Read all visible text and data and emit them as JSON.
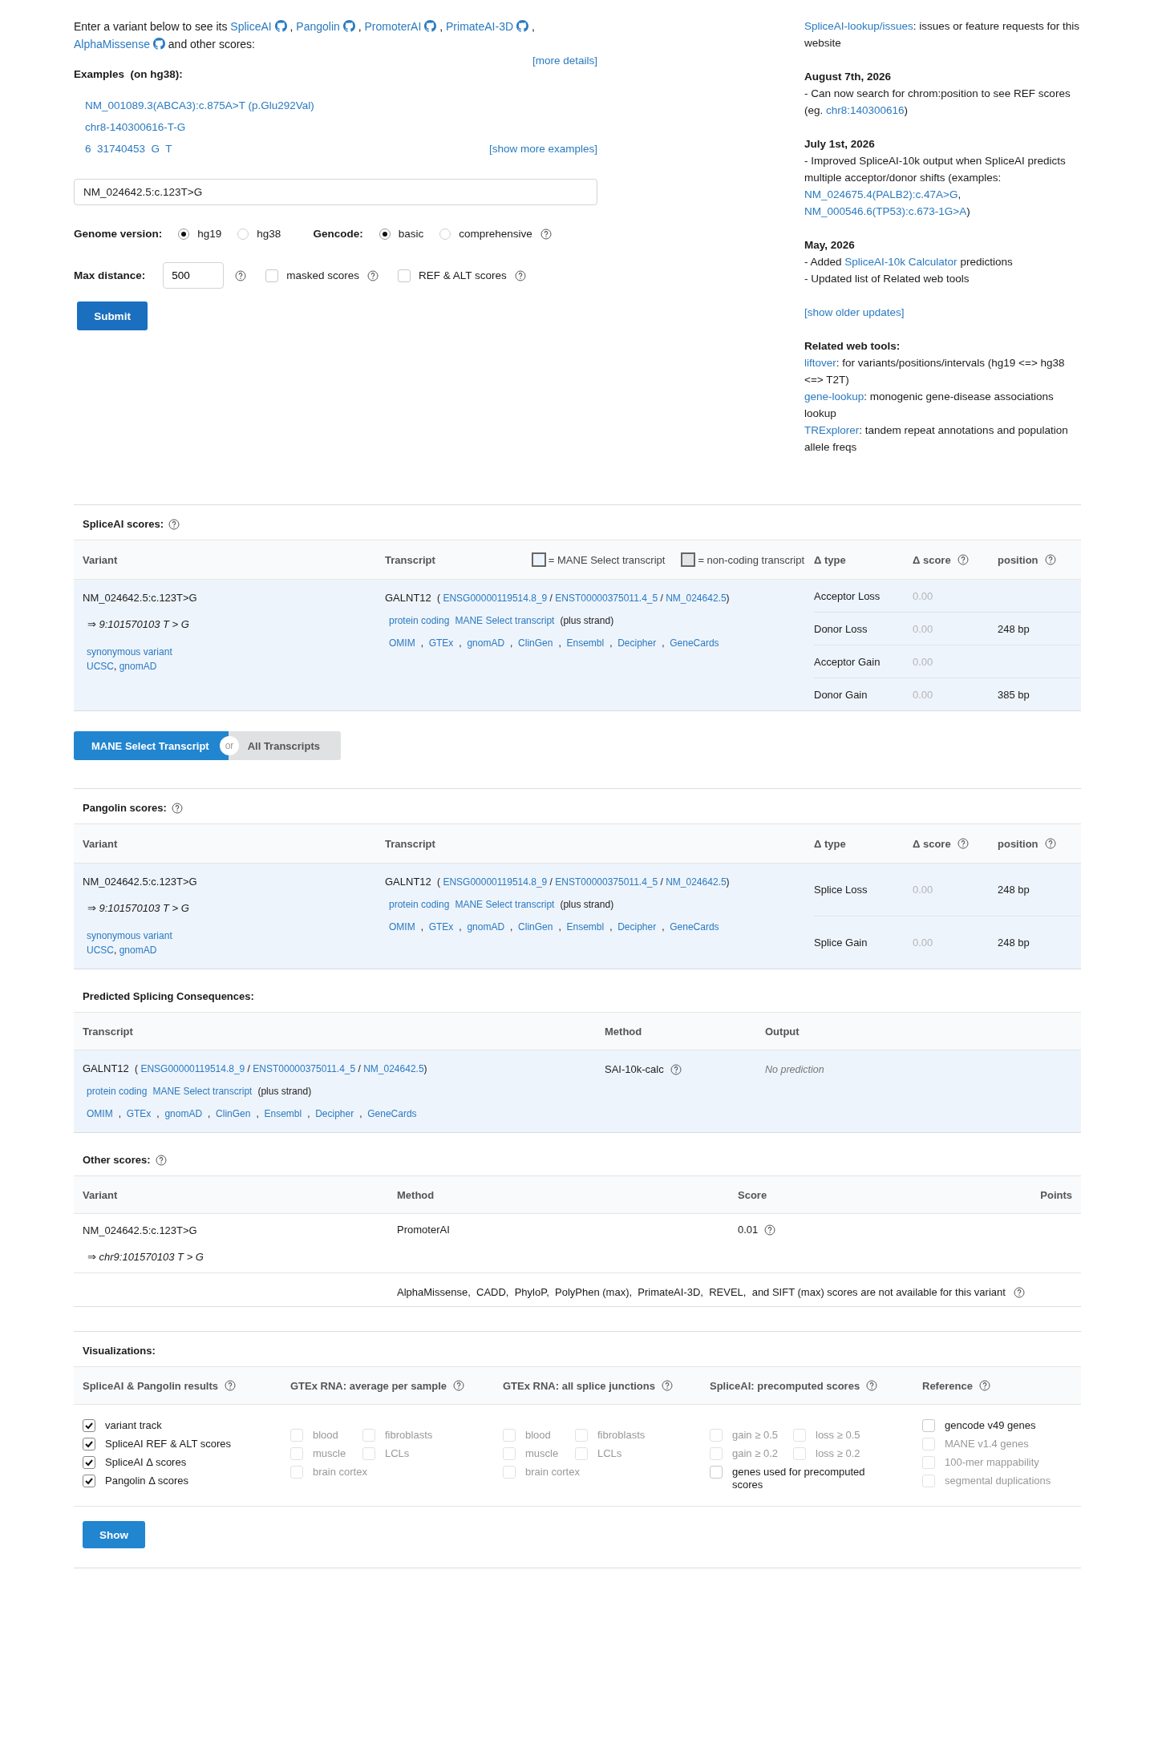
{
  "intro": {
    "parts": [
      {
        "kind": "text",
        "text": "Enter a variant below to see its "
      },
      {
        "kind": "link",
        "text": "SpliceAI",
        "github": true
      },
      {
        "kind": "text",
        "text": " , "
      },
      {
        "kind": "link",
        "text": "Pangolin",
        "github": true
      },
      {
        "kind": "text",
        "text": " , "
      },
      {
        "kind": "link",
        "text": "PromoterAI",
        "github": true
      },
      {
        "kind": "text",
        "text": " , "
      },
      {
        "kind": "link",
        "text": "PrimateAI-3D",
        "github": true
      },
      {
        "kind": "text",
        "text": " , "
      },
      {
        "kind": "link",
        "text": "AlphaMissense",
        "github": true
      },
      {
        "kind": "text",
        "text": " and other scores:"
      }
    ]
  },
  "more_details": "[more details]",
  "examples": {
    "title": "Examples  (on hg38):",
    "items": [
      "NM_001089.3(ABCA3):c.875A>T (p.Glu292Val)",
      "chr8-140300616-T-G",
      "6  31740453  G  T"
    ],
    "show_more": "[show more examples]"
  },
  "variant_input": {
    "value": "NM_024642.5:c.123T>G"
  },
  "genome": {
    "label": "Genome version:",
    "options": [
      {
        "label": "hg19",
        "selected": true
      },
      {
        "label": "hg38",
        "selected": false
      }
    ]
  },
  "gencode": {
    "label": "Gencode:",
    "options": [
      {
        "label": "basic",
        "selected": true
      },
      {
        "label": "comprehensive",
        "selected": false
      }
    ]
  },
  "max_distance": {
    "label": "Max distance:",
    "value": "500"
  },
  "options": [
    {
      "label": "masked scores",
      "checked": false
    },
    {
      "label": "REF & ALT scores",
      "checked": false
    }
  ],
  "submit": "Submit",
  "news": [
    {
      "lines": [
        [
          {
            "kind": "link",
            "text": "SpliceAI-lookup/issues"
          },
          {
            "kind": "text",
            "text": ": issues or feature requests for this website"
          }
        ]
      ]
    },
    {
      "heading": "August 7th, 2026",
      "lines": [
        [
          {
            "kind": "text",
            "text": "- Can now search for chrom:position to see REF scores (eg. "
          },
          {
            "kind": "link",
            "text": "chr8:140300616"
          },
          {
            "kind": "text",
            "text": ")"
          }
        ]
      ]
    },
    {
      "heading": "July 1st, 2026",
      "lines": [
        [
          {
            "kind": "text",
            "text": "- Improved SpliceAI-10k output when SpliceAI predicts multiple acceptor/donor shifts (examples: "
          },
          {
            "kind": "link",
            "text": "NM_024675.4(PALB2):c.47A>G"
          },
          {
            "kind": "text",
            "text": ", "
          },
          {
            "kind": "link",
            "text": "NM_000546.6(TP53):c.673-1G>A"
          },
          {
            "kind": "text",
            "text": ")"
          }
        ]
      ]
    },
    {
      "heading": "May, 2026",
      "lines": [
        [
          {
            "kind": "text",
            "text": "- Added "
          },
          {
            "kind": "link",
            "text": "SpliceAI-10k Calculator"
          },
          {
            "kind": "text",
            "text": " predictions"
          }
        ],
        [
          {
            "kind": "text",
            "text": "- Updated list of Related web tools"
          }
        ]
      ]
    },
    {
      "lines": [
        [
          {
            "kind": "link",
            "text": "[show older updates]"
          }
        ]
      ]
    },
    {
      "heading": "Related web tools:",
      "lines": [
        [
          {
            "kind": "link",
            "text": "liftover"
          },
          {
            "kind": "text",
            "text": ": for variants/positions/intervals (hg19 <=> hg38 <=> T2T)"
          }
        ],
        [
          {
            "kind": "link",
            "text": "gene-lookup"
          },
          {
            "kind": "text",
            "text": ": monogenic gene-disease associations lookup"
          }
        ],
        [
          {
            "kind": "link",
            "text": "TRExplorer"
          },
          {
            "kind": "text",
            "text": ": tandem repeat annotations and population allele freqs"
          }
        ]
      ]
    }
  ],
  "spliceai": {
    "title": "SpliceAI scores:",
    "columns": [
      {
        "label": "Variant"
      },
      {
        "label": "Transcript"
      },
      {
        "label": "Δ type"
      },
      {
        "label": "Δ score",
        "help": true
      },
      {
        "label": "position",
        "help": true
      }
    ],
    "legend": [
      {
        "label": "= MANE Select transcript",
        "kind": "mane"
      },
      {
        "label": "= non-coding transcript",
        "kind": "noncoding"
      }
    ],
    "variant": {
      "name": "NM_024642.5:c.123T>G",
      "detail": "⇒ 9:101570103 T > G",
      "links": [
        [
          {
            "kind": "link",
            "text": "synonymous variant"
          }
        ],
        [
          {
            "kind": "link",
            "text": "UCSC"
          },
          {
            "kind": "text",
            "text": ", "
          },
          {
            "kind": "link",
            "text": "gnomAD"
          }
        ]
      ]
    },
    "transcript": {
      "gene": "GALNT12",
      "ids": [
        {
          "kind": "text",
          "text": "( "
        },
        {
          "kind": "link",
          "text": "ENSG00000119514.8_9"
        },
        {
          "kind": "text",
          "text": " / "
        },
        {
          "kind": "link",
          "text": "ENST00000375011.4_5"
        },
        {
          "kind": "text",
          "text": " / "
        },
        {
          "kind": "link",
          "text": "NM_024642.5"
        },
        {
          "kind": "text",
          "text": ")"
        }
      ],
      "tags": [
        {
          "kind": "link",
          "text": "protein coding"
        },
        {
          "kind": "link",
          "text": "MANE Select transcript"
        },
        {
          "kind": "text",
          "text": "(plus strand)"
        }
      ],
      "links": [
        {
          "kind": "link",
          "text": "OMIM"
        },
        {
          "kind": "text",
          "text": ",  "
        },
        {
          "kind": "link",
          "text": "GTEx"
        },
        {
          "kind": "text",
          "text": ",  "
        },
        {
          "kind": "link",
          "text": "gnomAD"
        },
        {
          "kind": "text",
          "text": ",  "
        },
        {
          "kind": "link",
          "text": "ClinGen"
        },
        {
          "kind": "text",
          "text": ",  "
        },
        {
          "kind": "link",
          "text": "Ensembl"
        },
        {
          "kind": "text",
          "text": ",  "
        },
        {
          "kind": "link",
          "text": "Decipher"
        },
        {
          "kind": "text",
          "text": ",  "
        },
        {
          "kind": "link",
          "text": "GeneCards"
        }
      ]
    },
    "scores": [
      {
        "type": "Acceptor Loss",
        "score": "0.00"
      },
      {
        "type": "Donor Loss",
        "score": "0.00",
        "position": "248 bp"
      },
      {
        "type": "Acceptor Gain",
        "score": "0.00"
      },
      {
        "type": "Donor Gain",
        "score": "0.00",
        "position": "385 bp"
      }
    ]
  },
  "toggle": {
    "options": [
      {
        "label": "MANE Select Transcript",
        "selected": true
      },
      {
        "label": "All Transcripts",
        "selected": false
      }
    ],
    "or": "or"
  },
  "pangolin": {
    "title": "Pangolin scores:",
    "columns": [
      {
        "label": "Variant"
      },
      {
        "label": "Transcript"
      },
      {
        "label": "Δ type"
      },
      {
        "label": "Δ score",
        "help": true
      },
      {
        "label": "position",
        "help": true
      }
    ],
    "variant": {
      "name": "NM_024642.5:c.123T>G",
      "detail": "⇒ 9:101570103 T > G",
      "links": [
        [
          {
            "kind": "link",
            "text": "synonymous variant"
          }
        ],
        [
          {
            "kind": "link",
            "text": "UCSC"
          },
          {
            "kind": "text",
            "text": ", "
          },
          {
            "kind": "link",
            "text": "gnomAD"
          }
        ]
      ]
    },
    "transcript": {
      "gene": "GALNT12",
      "ids": [
        {
          "kind": "text",
          "text": "( "
        },
        {
          "kind": "link",
          "text": "ENSG00000119514.8_9"
        },
        {
          "kind": "text",
          "text": " / "
        },
        {
          "kind": "link",
          "text": "ENST00000375011.4_5"
        },
        {
          "kind": "text",
          "text": " / "
        },
        {
          "kind": "link",
          "text": "NM_024642.5"
        },
        {
          "kind": "text",
          "text": ")"
        }
      ],
      "tags": [
        {
          "kind": "link",
          "text": "protein coding"
        },
        {
          "kind": "link",
          "text": "MANE Select transcript"
        },
        {
          "kind": "text",
          "text": "(plus strand)"
        }
      ],
      "links": [
        {
          "kind": "link",
          "text": "OMIM"
        },
        {
          "kind": "text",
          "text": ",  "
        },
        {
          "kind": "link",
          "text": "GTEx"
        },
        {
          "kind": "text",
          "text": ",  "
        },
        {
          "kind": "link",
          "text": "gnomAD"
        },
        {
          "kind": "text",
          "text": ",  "
        },
        {
          "kind": "link",
          "text": "ClinGen"
        },
        {
          "kind": "text",
          "text": ",  "
        },
        {
          "kind": "link",
          "text": "Ensembl"
        },
        {
          "kind": "text",
          "text": ",  "
        },
        {
          "kind": "link",
          "text": "Decipher"
        },
        {
          "kind": "text",
          "text": ",  "
        },
        {
          "kind": "link",
          "text": "GeneCards"
        }
      ]
    },
    "scores": [
      {
        "type": "Splice Loss",
        "score": "0.00",
        "position": "248 bp"
      },
      {
        "type": "Splice Gain",
        "score": "0.00",
        "position": "248 bp"
      }
    ]
  },
  "predicted": {
    "title": "Predicted Splicing Consequences:",
    "columns": [
      {
        "label": "Transcript"
      },
      {
        "label": "Method"
      },
      {
        "label": "Output"
      }
    ],
    "transcript": {
      "gene": "GALNT12",
      "ids": [
        {
          "kind": "text",
          "text": "( "
        },
        {
          "kind": "link",
          "text": "ENSG00000119514.8_9"
        },
        {
          "kind": "text",
          "text": " / "
        },
        {
          "kind": "link",
          "text": "ENST00000375011.4_5"
        },
        {
          "kind": "text",
          "text": " / "
        },
        {
          "kind": "link",
          "text": "NM_024642.5"
        },
        {
          "kind": "text",
          "text": ")"
        }
      ],
      "tags": [
        {
          "kind": "link",
          "text": "protein coding"
        },
        {
          "kind": "link",
          "text": "MANE Select transcript"
        },
        {
          "kind": "text",
          "text": "(plus strand)"
        }
      ],
      "links": [
        {
          "kind": "link",
          "text": "OMIM"
        },
        {
          "kind": "text",
          "text": ",  "
        },
        {
          "kind": "link",
          "text": "GTEx"
        },
        {
          "kind": "text",
          "text": ",  "
        },
        {
          "kind": "link",
          "text": "gnomAD"
        },
        {
          "kind": "text",
          "text": ",  "
        },
        {
          "kind": "link",
          "text": "ClinGen"
        },
        {
          "kind": "text",
          "text": ",  "
        },
        {
          "kind": "link",
          "text": "Ensembl"
        },
        {
          "kind": "text",
          "text": ",  "
        },
        {
          "kind": "link",
          "text": "Decipher"
        },
        {
          "kind": "text",
          "text": ",  "
        },
        {
          "kind": "link",
          "text": "GeneCards"
        }
      ]
    },
    "method": "SAI-10k-calc",
    "output": "No prediction"
  },
  "other": {
    "title": "Other scores:",
    "columns": [
      {
        "label": "Variant"
      },
      {
        "label": "Method"
      },
      {
        "label": "Score"
      },
      {
        "label": "Points"
      }
    ],
    "variant": "NM_024642.5:c.123T>G",
    "detail": "⇒ chr9:101570103 T > G",
    "method": "PromoterAI",
    "score": "0.01",
    "note": "AlphaMissense,  CADD,  PhyloP,  PolyPhen (max),  PrimateAI-3D,  REVEL,  and SIFT (max) scores are not available for this variant"
  },
  "visualizations": {
    "title": "Visualizations:",
    "groups": [
      {
        "title": "SpliceAI & Pangolin results",
        "rows": [
          [
            {
              "label": "variant track",
              "checked": true,
              "disabled": false
            }
          ],
          [
            {
              "label": "SpliceAI REF & ALT scores",
              "checked": true,
              "disabled": false
            }
          ],
          [
            {
              "label": "SpliceAI Δ  scores",
              "checked": true,
              "disabled": false
            }
          ],
          [
            {
              "label": "Pangolin Δ  scores",
              "checked": true,
              "disabled": false
            }
          ]
        ]
      },
      {
        "title": "GTEx RNA: average per sample",
        "rows": [
          [
            {
              "label": "blood",
              "checked": false,
              "disabled": true
            },
            {
              "label": "fibroblasts",
              "checked": false,
              "disabled": true
            }
          ],
          [
            {
              "label": "muscle",
              "checked": false,
              "disabled": true
            },
            {
              "label": "LCLs",
              "checked": false,
              "disabled": true
            }
          ],
          [
            {
              "label": "brain cortex",
              "checked": false,
              "disabled": true
            }
          ]
        ]
      },
      {
        "title": "GTEx RNA: all splice junctions",
        "rows": [
          [
            {
              "label": "blood",
              "checked": false,
              "disabled": true
            },
            {
              "label": "fibroblasts",
              "checked": false,
              "disabled": true
            }
          ],
          [
            {
              "label": "muscle",
              "checked": false,
              "disabled": true
            },
            {
              "label": "LCLs",
              "checked": false,
              "disabled": true
            }
          ],
          [
            {
              "label": "brain cortex",
              "checked": false,
              "disabled": true
            }
          ]
        ]
      },
      {
        "title": "SpliceAI: precomputed scores",
        "rows": [
          [
            {
              "label": "gain ≥ 0.5",
              "checked": false,
              "disabled": true
            },
            {
              "label": "loss ≥ 0.5",
              "checked": false,
              "disabled": true
            }
          ],
          [
            {
              "label": "gain ≥ 0.2",
              "checked": false,
              "disabled": true
            },
            {
              "label": "loss ≥ 0.2",
              "checked": false,
              "disabled": true
            }
          ],
          [
            {
              "label": "genes used for precomputed scores",
              "checked": false,
              "disabled": false
            }
          ]
        ]
      },
      {
        "title": "Reference",
        "rows": [
          [
            {
              "label": "gencode v49 genes",
              "checked": false,
              "disabled": false
            }
          ],
          [
            {
              "label": "MANE v1.4 genes",
              "checked": false,
              "disabled": true
            }
          ],
          [
            {
              "label": "100-mer mappability",
              "checked": false,
              "disabled": true
            }
          ],
          [
            {
              "label": "segmental duplications",
              "checked": false,
              "disabled": true
            }
          ]
        ]
      }
    ],
    "button": "Show"
  }
}
